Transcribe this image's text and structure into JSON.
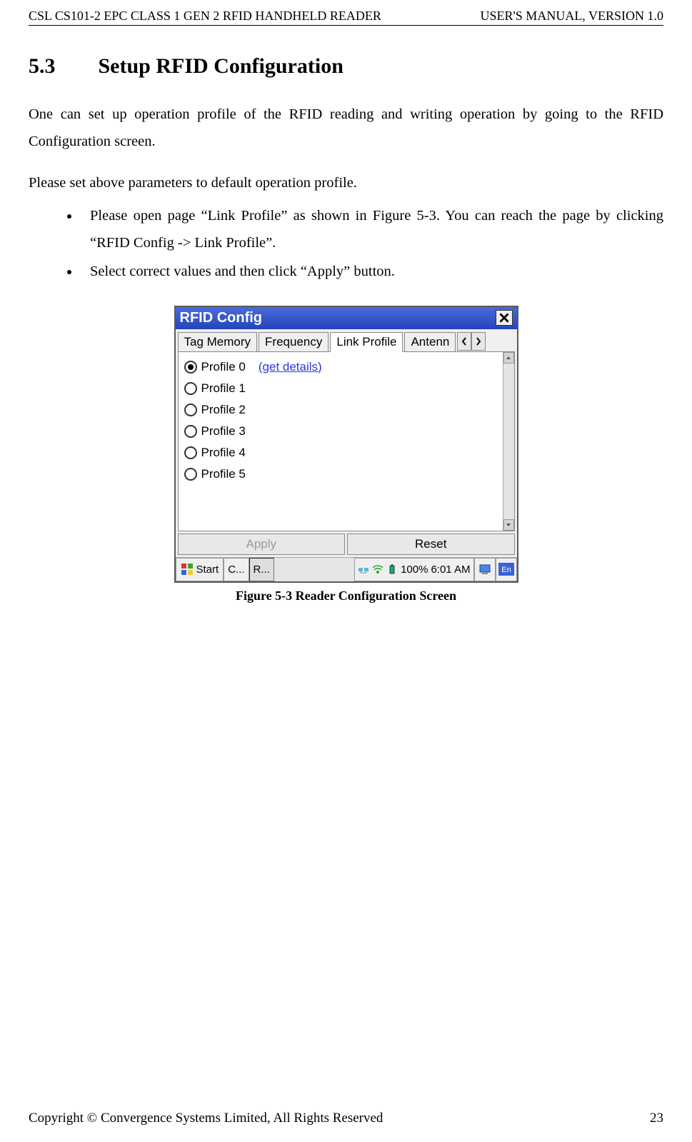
{
  "header": {
    "left": "CSL CS101-2 EPC CLASS 1 GEN 2 RFID HANDHELD READER",
    "right": "USER'S  MANUAL,  VERSION  1.0"
  },
  "heading": {
    "number": "5.3",
    "title": "Setup RFID Configuration"
  },
  "paragraphs": {
    "p1": "One can set up operation profile of the RFID reading and writing operation by going to the RFID Configuration screen.",
    "p2": "Please set above parameters to default operation profile."
  },
  "bullets": {
    "b1": "Please open page “Link Profile” as shown in Figure 5-3. You can reach the page by clicking “RFID Config -> Link Profile”.",
    "b2": "Select correct values and then click “Apply” button."
  },
  "window": {
    "title": "RFID Config",
    "tabs": {
      "t1": "Tag Memory",
      "t2": "Frequency",
      "t3": "Link Profile",
      "t4": "Antenn"
    },
    "radios": {
      "r0": "Profile 0",
      "r1": "Profile 1",
      "r2": "Profile 2",
      "r3": "Profile 3",
      "r4": "Profile 4",
      "r5": "Profile 5"
    },
    "details_link": "(get details)",
    "buttons": {
      "apply": "Apply",
      "reset": "Reset"
    },
    "taskbar": {
      "start": "Start",
      "item1": "C...",
      "item2": "R...",
      "battery": "100%",
      "time": "6:01 AM",
      "lang": "En"
    }
  },
  "caption": "Figure 5-3 Reader Configuration Screen",
  "footer": {
    "left": "Copyright © Convergence Systems Limited, All Rights Reserved",
    "right": "23"
  }
}
